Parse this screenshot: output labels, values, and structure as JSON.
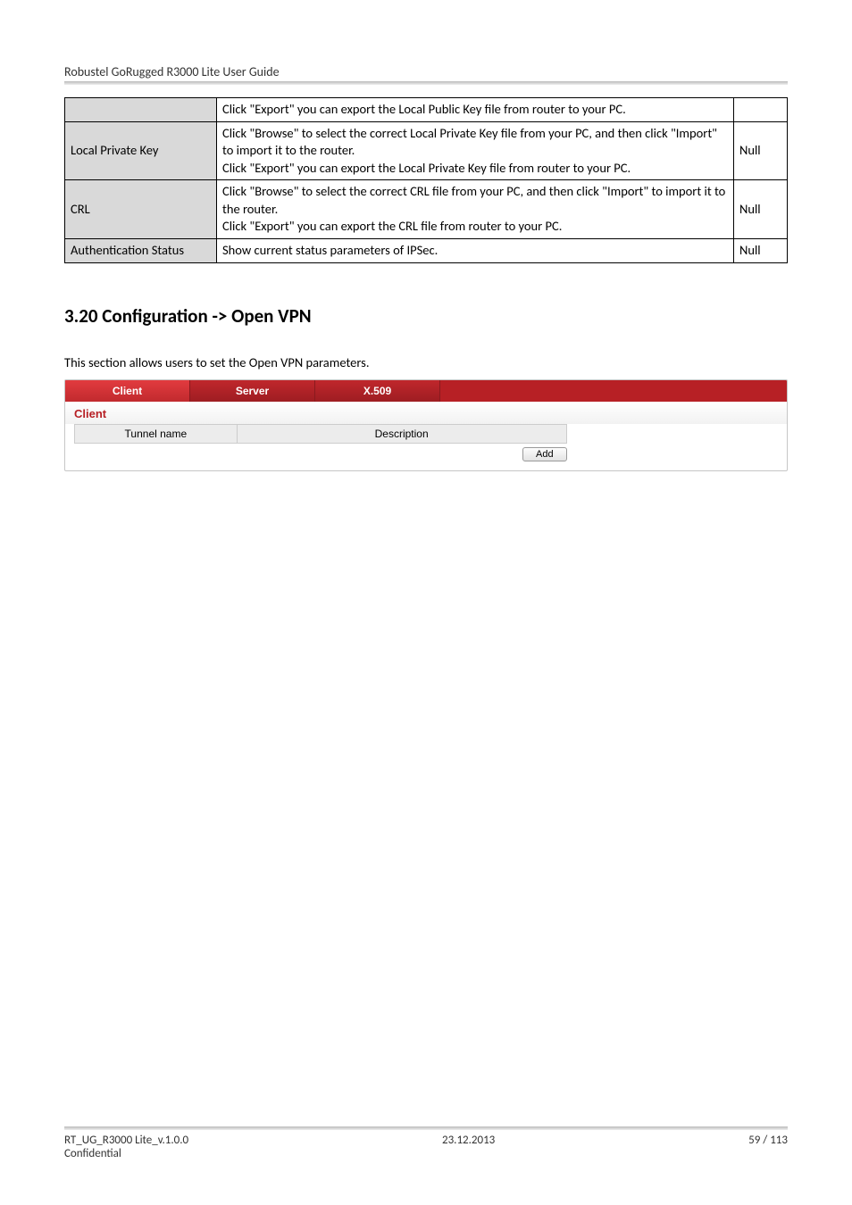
{
  "header": {
    "title": "Robustel GoRugged R3000 Lite User Guide"
  },
  "table": {
    "rows": [
      {
        "c1": "",
        "c2": "Click \"Export\" you can export the Local Public Key file from router to your PC.",
        "c3": ""
      },
      {
        "c1": "Local Private Key",
        "c2": "Click \"Browse\" to select the correct Local Private Key file from your PC, and then click \"Import\" to import it to the router.\nClick \"Export\" you can export the Local Private Key file from router to your PC.",
        "c3": "Null"
      },
      {
        "c1": "CRL",
        "c2": "Click \"Browse\" to select the correct CRL file from your PC, and then click \"Import\" to import it to the router.\nClick \"Export\" you can export the CRL file from router to your PC.",
        "c3": "Null"
      },
      {
        "c1": "Authentication Status",
        "c2": "Show current status parameters of IPSec.",
        "c3": "Null"
      }
    ]
  },
  "section": {
    "heading": "3.20  Configuration -> Open VPN",
    "intro": "This section allows users to set the Open VPN parameters."
  },
  "tabs": {
    "items": [
      {
        "label": "Client",
        "active": true
      },
      {
        "label": "Server",
        "active": false
      },
      {
        "label": "X.509",
        "active": false
      }
    ],
    "panel_title": "Client",
    "col_a": "Tunnel name",
    "col_b": "Description",
    "add_label": "Add"
  },
  "footer": {
    "left1": "RT_UG_R3000 Lite_v.1.0.0",
    "left2": "Confidential",
    "center": "23.12.2013",
    "right": "59 / 113"
  }
}
